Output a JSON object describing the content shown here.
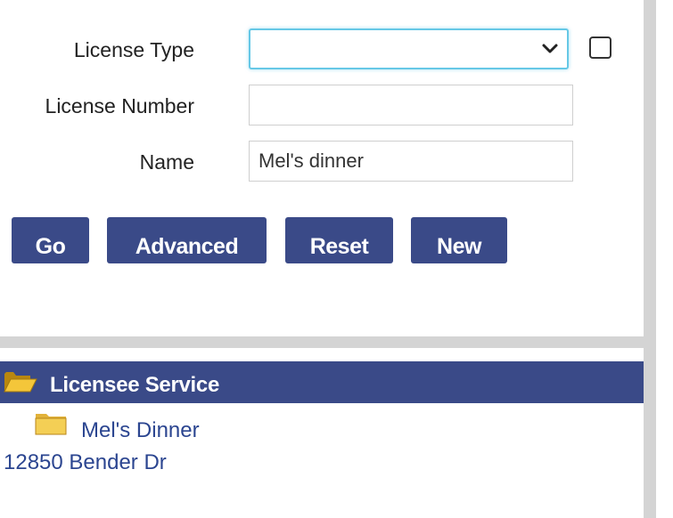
{
  "search_form": {
    "license_type": {
      "label": "License Type",
      "value": ""
    },
    "license_number": {
      "label": "License Number",
      "value": ""
    },
    "name": {
      "label": "Name",
      "value": "Mel's dinner"
    }
  },
  "buttons": {
    "go": "Go",
    "advanced": "Advanced",
    "reset": "Reset",
    "new": "New"
  },
  "results": {
    "header": "Licensee Service",
    "items": [
      {
        "name": "Mel's Dinner",
        "address": "12850 Bender Dr"
      }
    ]
  },
  "colors": {
    "accent": "#3a4a88",
    "link": "#2b4590",
    "focus": "#66c8e6",
    "scrollbar": "#d4d4d4"
  },
  "icons": {
    "dropdown": "chevron-down-icon",
    "header_folder": "folder-open-icon",
    "item_folder": "folder-icon"
  }
}
